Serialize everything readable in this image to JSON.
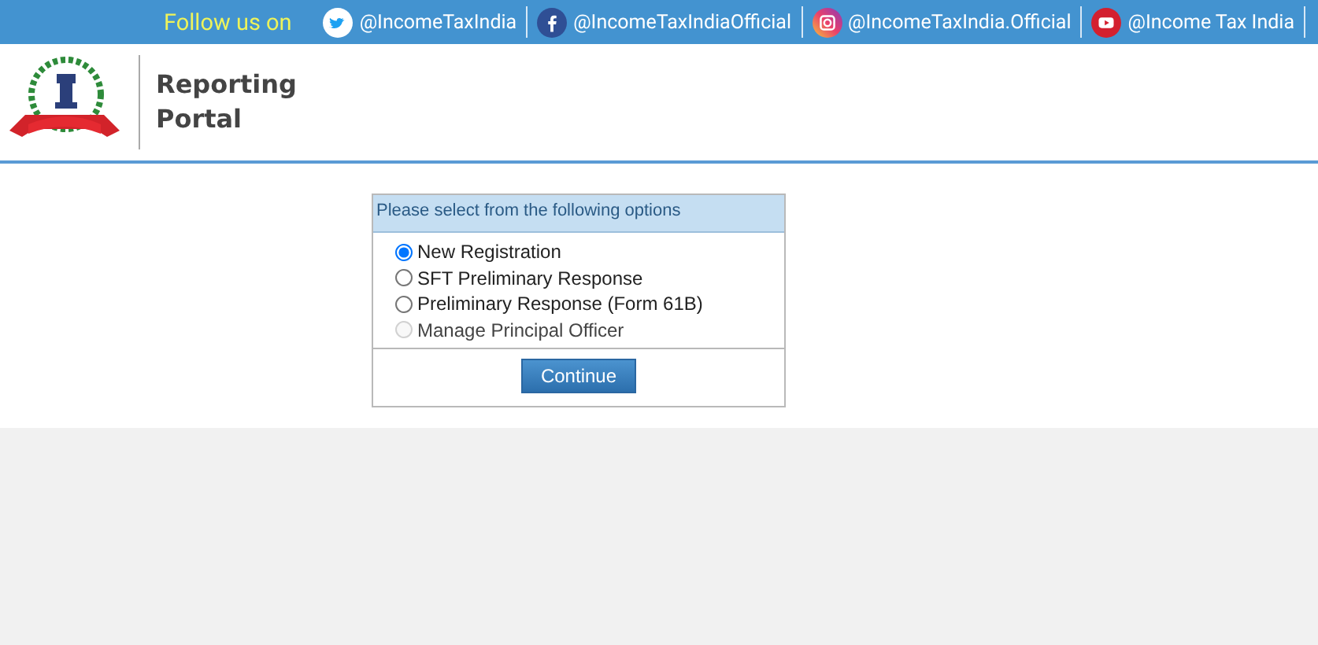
{
  "top_bar": {
    "follow_label": "Follow us on",
    "social_links": [
      {
        "kind": "twitter",
        "handle": "@IncomeTaxIndia"
      },
      {
        "kind": "facebook",
        "handle": "@IncomeTaxIndiaOfficial"
      },
      {
        "kind": "instagram",
        "handle": "@IncomeTaxIndia.Official"
      },
      {
        "kind": "youtube",
        "handle": "@Income Tax India"
      }
    ]
  },
  "header": {
    "title_lines": [
      "Reporting",
      "Portal"
    ]
  },
  "options_panel": {
    "heading": "Please select from the following options",
    "options": [
      {
        "label": "New Registration",
        "selected": true,
        "disabled": false
      },
      {
        "label": "SFT Preliminary Response",
        "selected": false,
        "disabled": false
      },
      {
        "label": "Preliminary Response (Form 61B)",
        "selected": false,
        "disabled": false
      },
      {
        "label": "Manage Principal Officer",
        "selected": false,
        "disabled": true
      }
    ],
    "button": "Continue"
  }
}
